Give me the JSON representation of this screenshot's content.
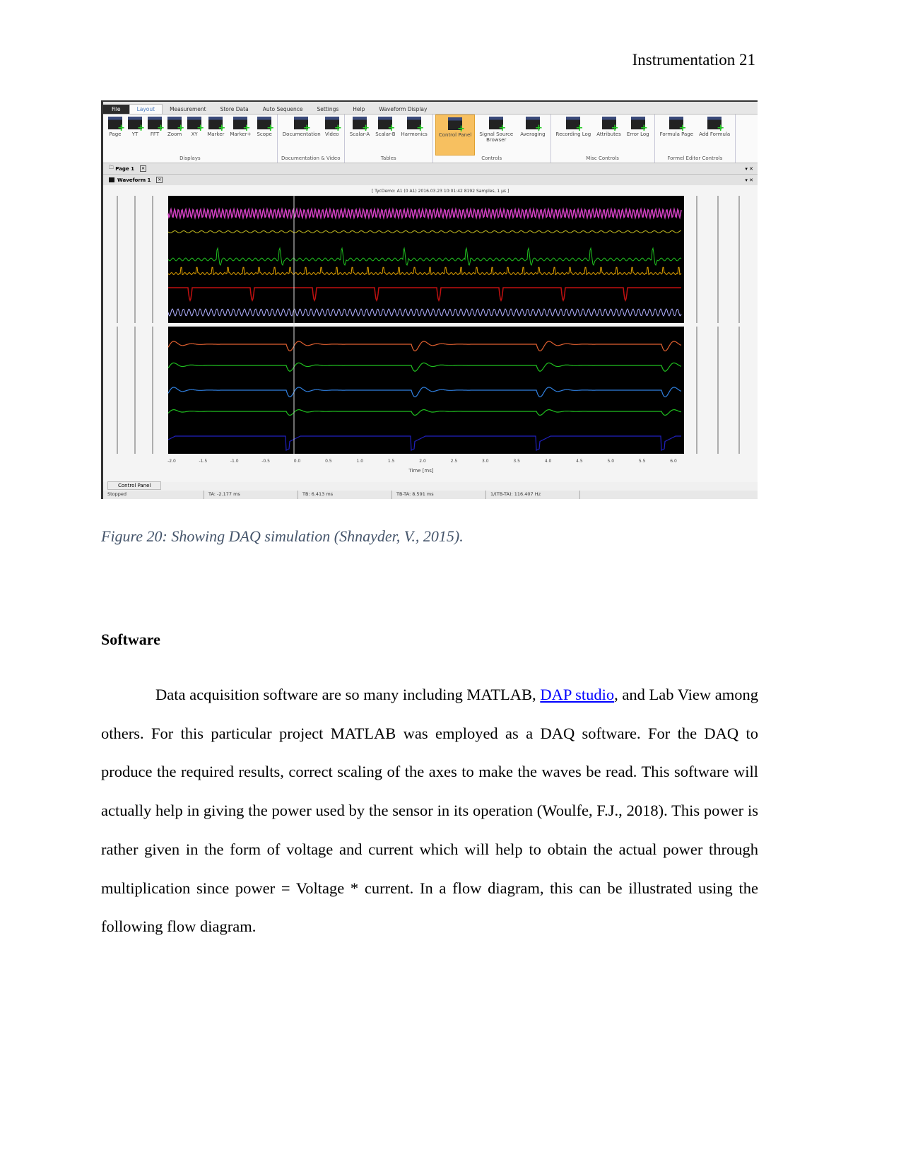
{
  "header": {
    "running_head": "Instrumentation 21"
  },
  "screenshot": {
    "menu_tabs": [
      "File",
      "Layout",
      "Measurement",
      "Store Data",
      "Auto Sequence",
      "Settings",
      "Help",
      "Waveform Display"
    ],
    "active_tab": "Layout",
    "groups": [
      {
        "label": "Displays",
        "buttons": [
          "Page",
          "YT",
          "FFT",
          "Zoom",
          "XY",
          "Marker",
          "Marker+",
          "Scope"
        ]
      },
      {
        "label": "Documentation & Video",
        "buttons": [
          "Documentation",
          "Video"
        ]
      },
      {
        "label": "Tables",
        "buttons": [
          "Scalar-A",
          "Scalar-B",
          "Harmonics"
        ]
      },
      {
        "label": "Controls",
        "buttons": [
          "Control Panel",
          "Signal Source Browser",
          "Averaging"
        ]
      },
      {
        "label": "Misc Controls",
        "buttons": [
          "Recording Log",
          "Attributes",
          "Error Log"
        ]
      },
      {
        "label": "Formel Editor Controls",
        "buttons": [
          "Formula Page",
          "Add Formula"
        ]
      }
    ],
    "selected_button": "Control Panel",
    "page_tab": "Page 1",
    "waveform_tab": "Waveform 1",
    "plot_info": "[ TycDemo: A1 (0 A1) 2016.03.23 10:01:42 8192 Samples, 1 µs ]",
    "x_ticks": [
      "-2.0",
      "-1.5",
      "-1.0",
      "-0.5",
      "0.0",
      "0.5",
      "1.0",
      "1.5",
      "2.0",
      "2.5",
      "3.0",
      "3.5",
      "4.0",
      "4.5",
      "5.0",
      "5.5",
      "6.0"
    ],
    "x_label": "Time [ms]",
    "control_panel_tab": "Control Panel",
    "status": [
      "Stopped",
      "TA: -2.177 ms",
      "TB: 6.413 ms",
      "TB-TA: 8.591 ms",
      "1/(TB-TA): 116.407 Hz"
    ],
    "trace_colors": {
      "magenta": "#d040c0",
      "yellow": "#c8c020",
      "green": "#20c020",
      "orange": "#e0a000",
      "red": "#c01010",
      "lavender": "#b0b0ff",
      "orange2": "#e06030",
      "blue": "#3080e0",
      "navy": "#2020c0"
    }
  },
  "caption": "Figure 20: Showing DAQ simulation  (Shnayder, V., 2015).",
  "section_heading": "Software",
  "paragraph": {
    "before_link": "Data acquisition software are so many including MATLAB, ",
    "link": "DAP studio",
    "after_link": ", and Lab View among others.  For this particular project   MATLAB was employed as a DAQ software.  For the DAQ to produce the required results, correct scaling of the axes to make the waves be read. This software will actually help in giving the power used by the sensor in its operation (Woulfe, F.J., 2018). This power is rather given in the form of voltage and current which will help to obtain the actual power through multiplication since power = Voltage * current.  In a flow diagram, this can be illustrated using the following flow diagram."
  }
}
